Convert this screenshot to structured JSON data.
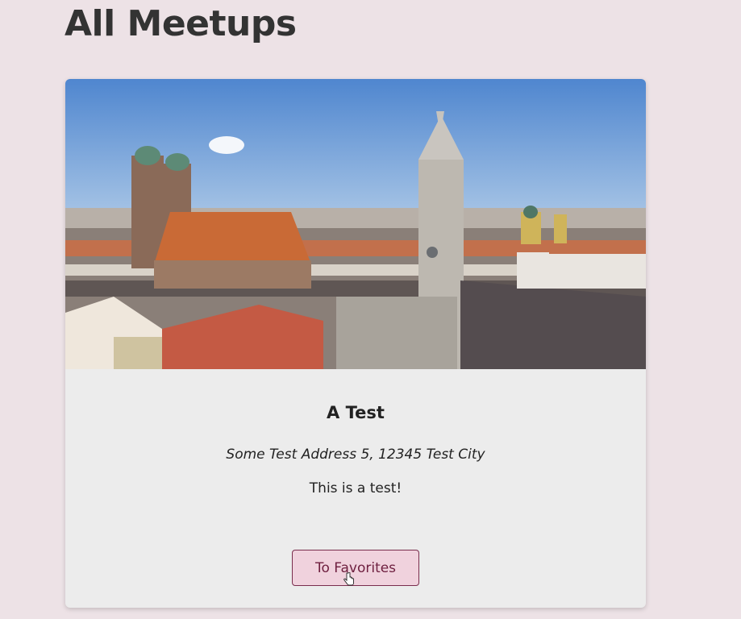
{
  "header": {
    "title": "All Meetups"
  },
  "meetup": {
    "image_icon": "munich-city-photo",
    "title": "A Test",
    "address": "Some Test Address 5, 12345 Test City",
    "description": "This is a test!",
    "favorite_button_label": "To Favorites"
  },
  "colors": {
    "background": "#ede2e6",
    "card": "#ececec",
    "button_bg": "#f0d2dd",
    "button_border": "#7a2d4d",
    "button_text": "#6e1f3f"
  }
}
